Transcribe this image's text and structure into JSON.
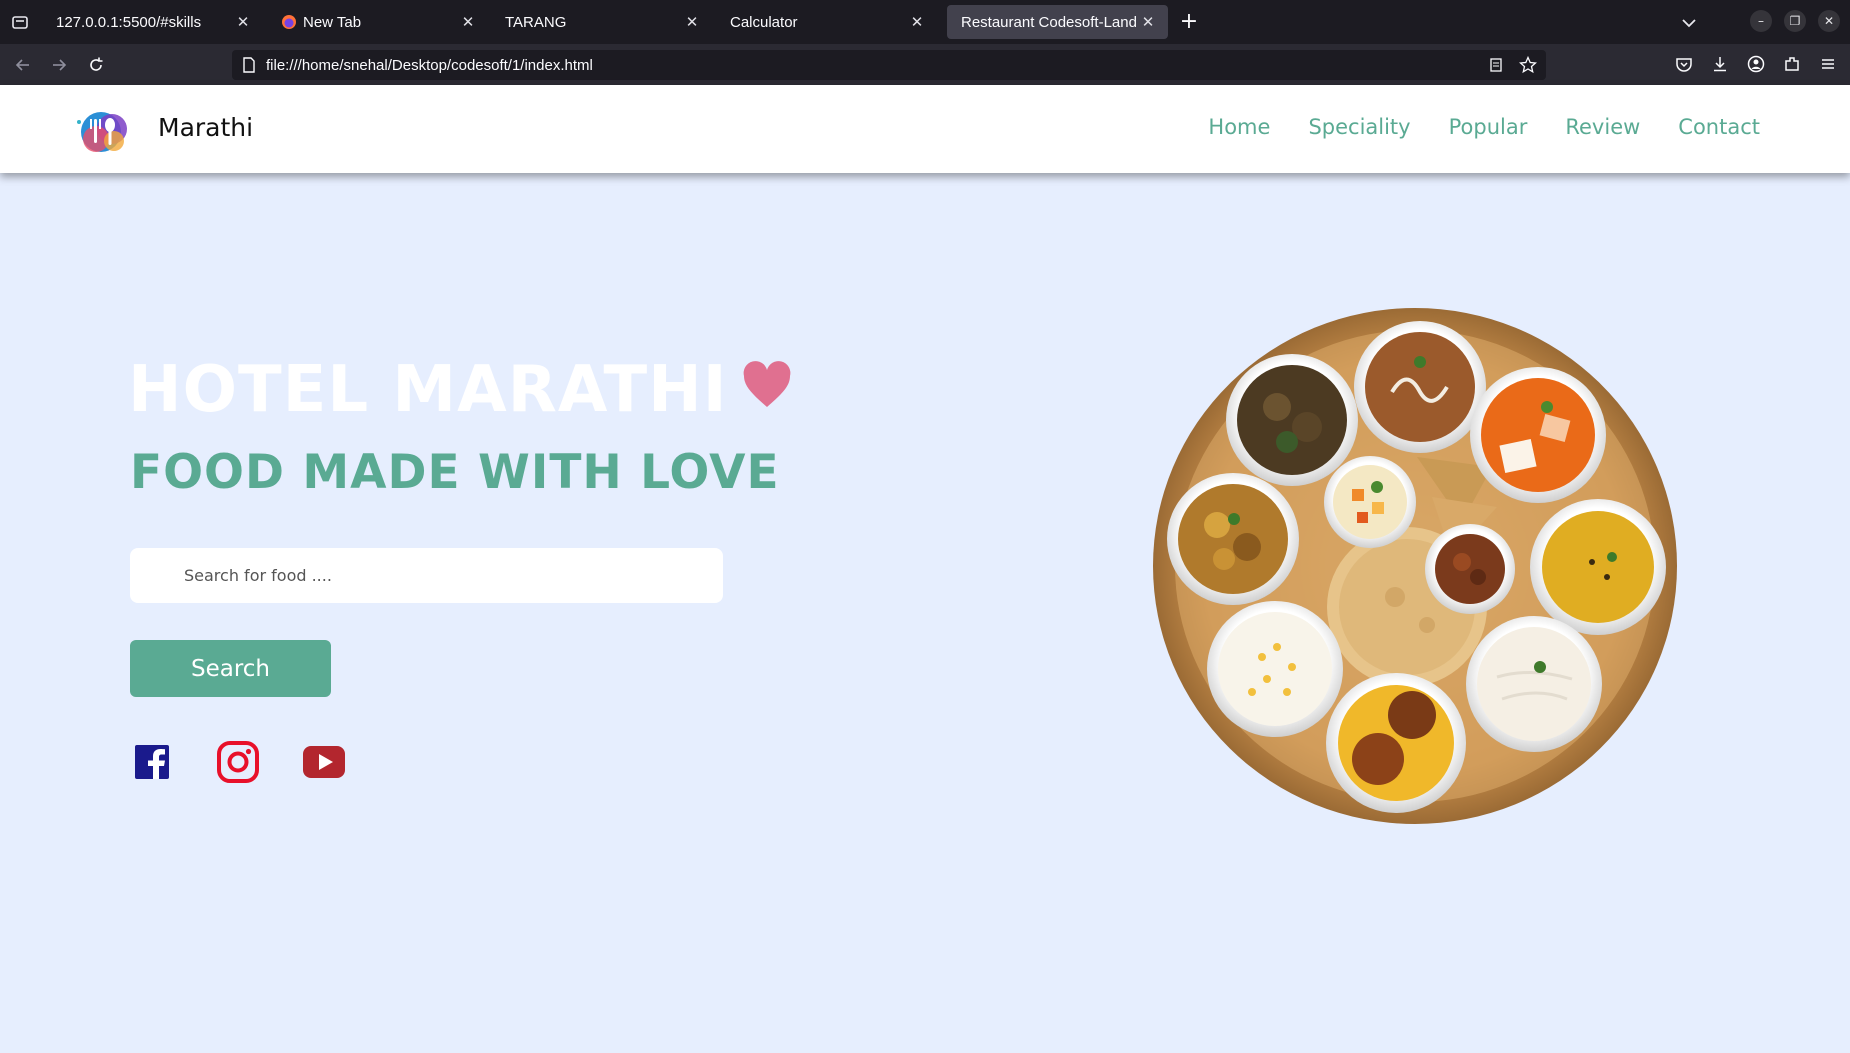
{
  "browser": {
    "tabs": [
      {
        "title": "127.0.0.1:5500/#skills",
        "active": false
      },
      {
        "title": "New Tab",
        "active": false
      },
      {
        "title": "TARANG",
        "active": false
      },
      {
        "title": "Calculator",
        "active": false
      },
      {
        "title": "Restaurant Codesoft-Landing",
        "active": true
      }
    ],
    "url": "file:///home/snehal/Desktop/codesoft/1/index.html",
    "icons": [
      "tab-list-icon",
      "firefox-icon",
      "close-icon",
      "new-tab-icon",
      "chevron-down-icon",
      "minimize-icon",
      "restore-icon",
      "window-close-icon",
      "back-arrow-icon",
      "forward-arrow-icon",
      "reload-icon",
      "page-icon",
      "reader-view-icon",
      "bookmark-star-icon",
      "pocket-icon",
      "download-icon",
      "account-icon",
      "extensions-icon",
      "menu-icon"
    ]
  },
  "site": {
    "brand": "Marathi",
    "nav": [
      "Home",
      "Speciality",
      "Popular",
      "Review",
      "Contact"
    ],
    "hero": {
      "title": "HOTEL MARATHI",
      "subtitle": "FOOD MADE WITH LOVE",
      "search_placeholder": "Search for food ....",
      "search_button": "Search"
    },
    "social_icons": [
      "facebook-icon",
      "instagram-icon",
      "youtube-icon"
    ],
    "colors": {
      "accent": "#5aaa93",
      "background": "#e6eefe",
      "heart": "#e07090",
      "facebook": "#1a1a8c",
      "instagram": "#e8102a",
      "youtube": "#b3262e"
    }
  }
}
